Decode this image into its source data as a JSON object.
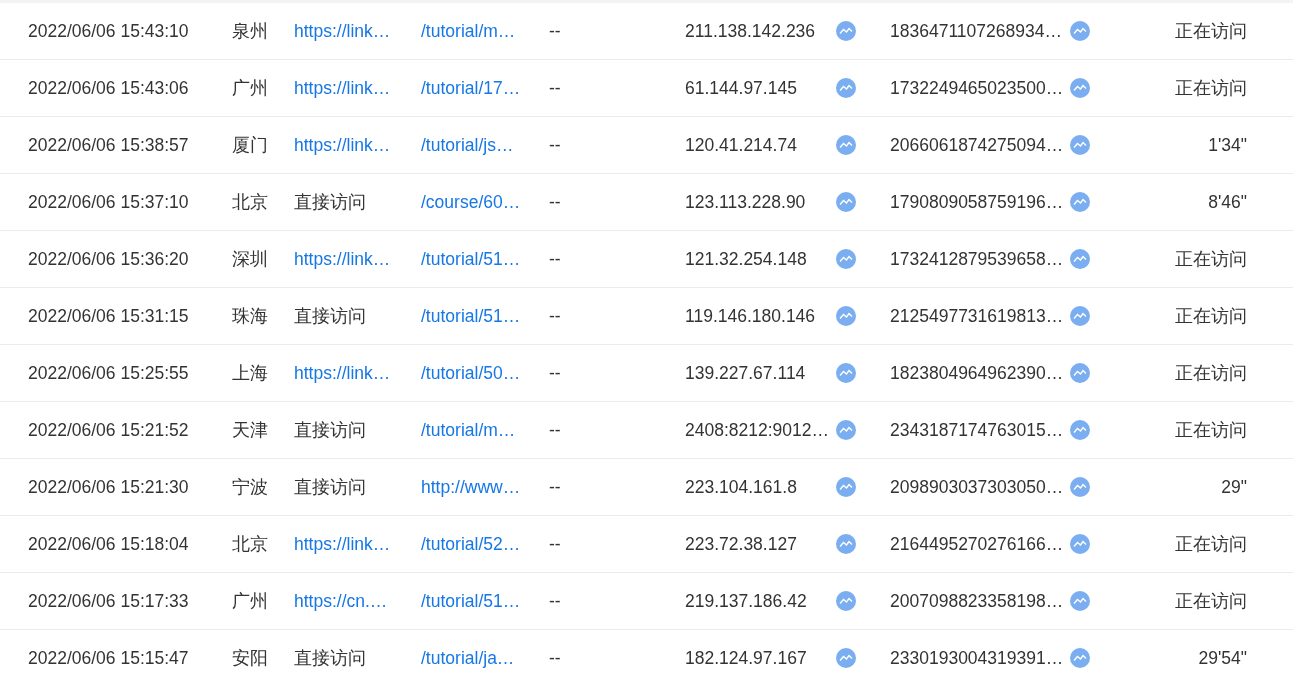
{
  "rows": [
    {
      "time": "2022/06/06 15:43:10",
      "city": "泉州",
      "source": {
        "text": "https://link…",
        "kind": "link"
      },
      "page": "/tutorial/m…",
      "column_5": "--",
      "ip": "211.138.142.236",
      "visitor_id": "1836471107268934…",
      "duration": "正在访问"
    },
    {
      "time": "2022/06/06 15:43:06",
      "city": "广州",
      "source": {
        "text": "https://link…",
        "kind": "link"
      },
      "page": "/tutorial/17…",
      "column_5": "--",
      "ip": "61.144.97.145",
      "visitor_id": "1732249465023500…",
      "duration": "正在访问"
    },
    {
      "time": "2022/06/06 15:38:57",
      "city": "厦门",
      "source": {
        "text": "https://link…",
        "kind": "link"
      },
      "page": "/tutorial/js…",
      "column_5": "--",
      "ip": "120.41.214.74",
      "visitor_id": "2066061874275094…",
      "duration": "1'34\""
    },
    {
      "time": "2022/06/06 15:37:10",
      "city": "北京",
      "source": {
        "text": "直接访问",
        "kind": "direct"
      },
      "page": "/course/60…",
      "column_5": "--",
      "ip": "123.113.228.90",
      "visitor_id": "1790809058759196…",
      "duration": "8'46\""
    },
    {
      "time": "2022/06/06 15:36:20",
      "city": "深圳",
      "source": {
        "text": "https://link…",
        "kind": "link"
      },
      "page": "/tutorial/51…",
      "column_5": "--",
      "ip": "121.32.254.148",
      "visitor_id": "1732412879539658…",
      "duration": "正在访问"
    },
    {
      "time": "2022/06/06 15:31:15",
      "city": "珠海",
      "source": {
        "text": "直接访问",
        "kind": "direct"
      },
      "page": "/tutorial/51…",
      "column_5": "--",
      "ip": "119.146.180.146",
      "visitor_id": "2125497731619813…",
      "duration": "正在访问"
    },
    {
      "time": "2022/06/06 15:25:55",
      "city": "上海",
      "source": {
        "text": "https://link…",
        "kind": "link"
      },
      "page": "/tutorial/50…",
      "column_5": "--",
      "ip": "139.227.67.114",
      "visitor_id": "1823804964962390…",
      "duration": "正在访问"
    },
    {
      "time": "2022/06/06 15:21:52",
      "city": "天津",
      "source": {
        "text": "直接访问",
        "kind": "direct"
      },
      "page": "/tutorial/m…",
      "column_5": "--",
      "ip": "2408:8212:9012…",
      "visitor_id": "2343187174763015…",
      "duration": "正在访问"
    },
    {
      "time": "2022/06/06 15:21:30",
      "city": "宁波",
      "source": {
        "text": "直接访问",
        "kind": "direct"
      },
      "page": "http://www…",
      "column_5": "--",
      "ip": "223.104.161.8",
      "visitor_id": "2098903037303050…",
      "duration": "29\""
    },
    {
      "time": "2022/06/06 15:18:04",
      "city": "北京",
      "source": {
        "text": "https://link…",
        "kind": "link"
      },
      "page": "/tutorial/52…",
      "column_5": "--",
      "ip": "223.72.38.127",
      "visitor_id": "2164495270276166…",
      "duration": "正在访问"
    },
    {
      "time": "2022/06/06 15:17:33",
      "city": "广州",
      "source": {
        "text": "https://cn.…",
        "kind": "link"
      },
      "page": "/tutorial/51…",
      "column_5": "--",
      "ip": "219.137.186.42",
      "visitor_id": "2007098823358198…",
      "duration": "正在访问"
    },
    {
      "time": "2022/06/06 15:15:47",
      "city": "安阳",
      "source": {
        "text": "直接访问",
        "kind": "direct"
      },
      "page": "/tutorial/ja…",
      "column_5": "--",
      "ip": "182.124.97.167",
      "visitor_id": "2330193004319391…",
      "duration": "29'54\""
    }
  ]
}
